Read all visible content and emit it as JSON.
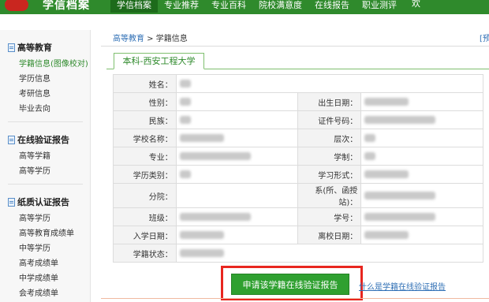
{
  "topbar": {
    "logo_text": "学信档案",
    "nav": [
      "学信档案",
      "专业推荐",
      "专业百科",
      "院校满意度",
      "在线报告",
      "职业测评"
    ],
    "right_text": "欢"
  },
  "sidebar": {
    "groups": [
      {
        "title": "高等教育",
        "items": [
          "学籍信息(图像校对)",
          "学历信息",
          "考研信息",
          "毕业去向"
        ]
      },
      {
        "title": "在线验证报告",
        "items": [
          "高等学籍",
          "高等学历"
        ]
      },
      {
        "title": "纸质认证报告",
        "items": [
          "高等学历",
          "高等教育成绩单",
          "中等学历",
          "高考成绩单",
          "中学成绩单",
          "会考成绩单"
        ]
      }
    ]
  },
  "breadcrumb": {
    "link": "高等教育",
    "sep": " > ",
    "current": "学籍信息",
    "right": "[预"
  },
  "tab": {
    "label": "本科-西安工程大学"
  },
  "table": {
    "rows": [
      {
        "l1": "姓名：",
        "l2": ""
      },
      {
        "l1": "性别：",
        "l2": "出生日期："
      },
      {
        "l1": "民族：",
        "l2": "证件号码："
      },
      {
        "l1": "学校名称：",
        "l2": "层次："
      },
      {
        "l1": "专业：",
        "l2": "学制："
      },
      {
        "l1": "学历类别：",
        "l2": "学习形式："
      },
      {
        "l1": "分院：",
        "l2": "系(所、函授站)："
      },
      {
        "l1": "班级：",
        "l2": "学号："
      },
      {
        "l1": "入学日期：",
        "l2": "离校日期："
      },
      {
        "l1": "学籍状态：",
        "l2": ""
      }
    ]
  },
  "actions": {
    "apply_label": "申请该学籍在线验证报告",
    "help_label": "什么是学籍在线验证报告"
  },
  "colors": {
    "brand_green": "#2f8a2c",
    "button_green": "#2fa030",
    "highlight_red": "#e8261f",
    "link_blue": "#2f6fb5"
  }
}
